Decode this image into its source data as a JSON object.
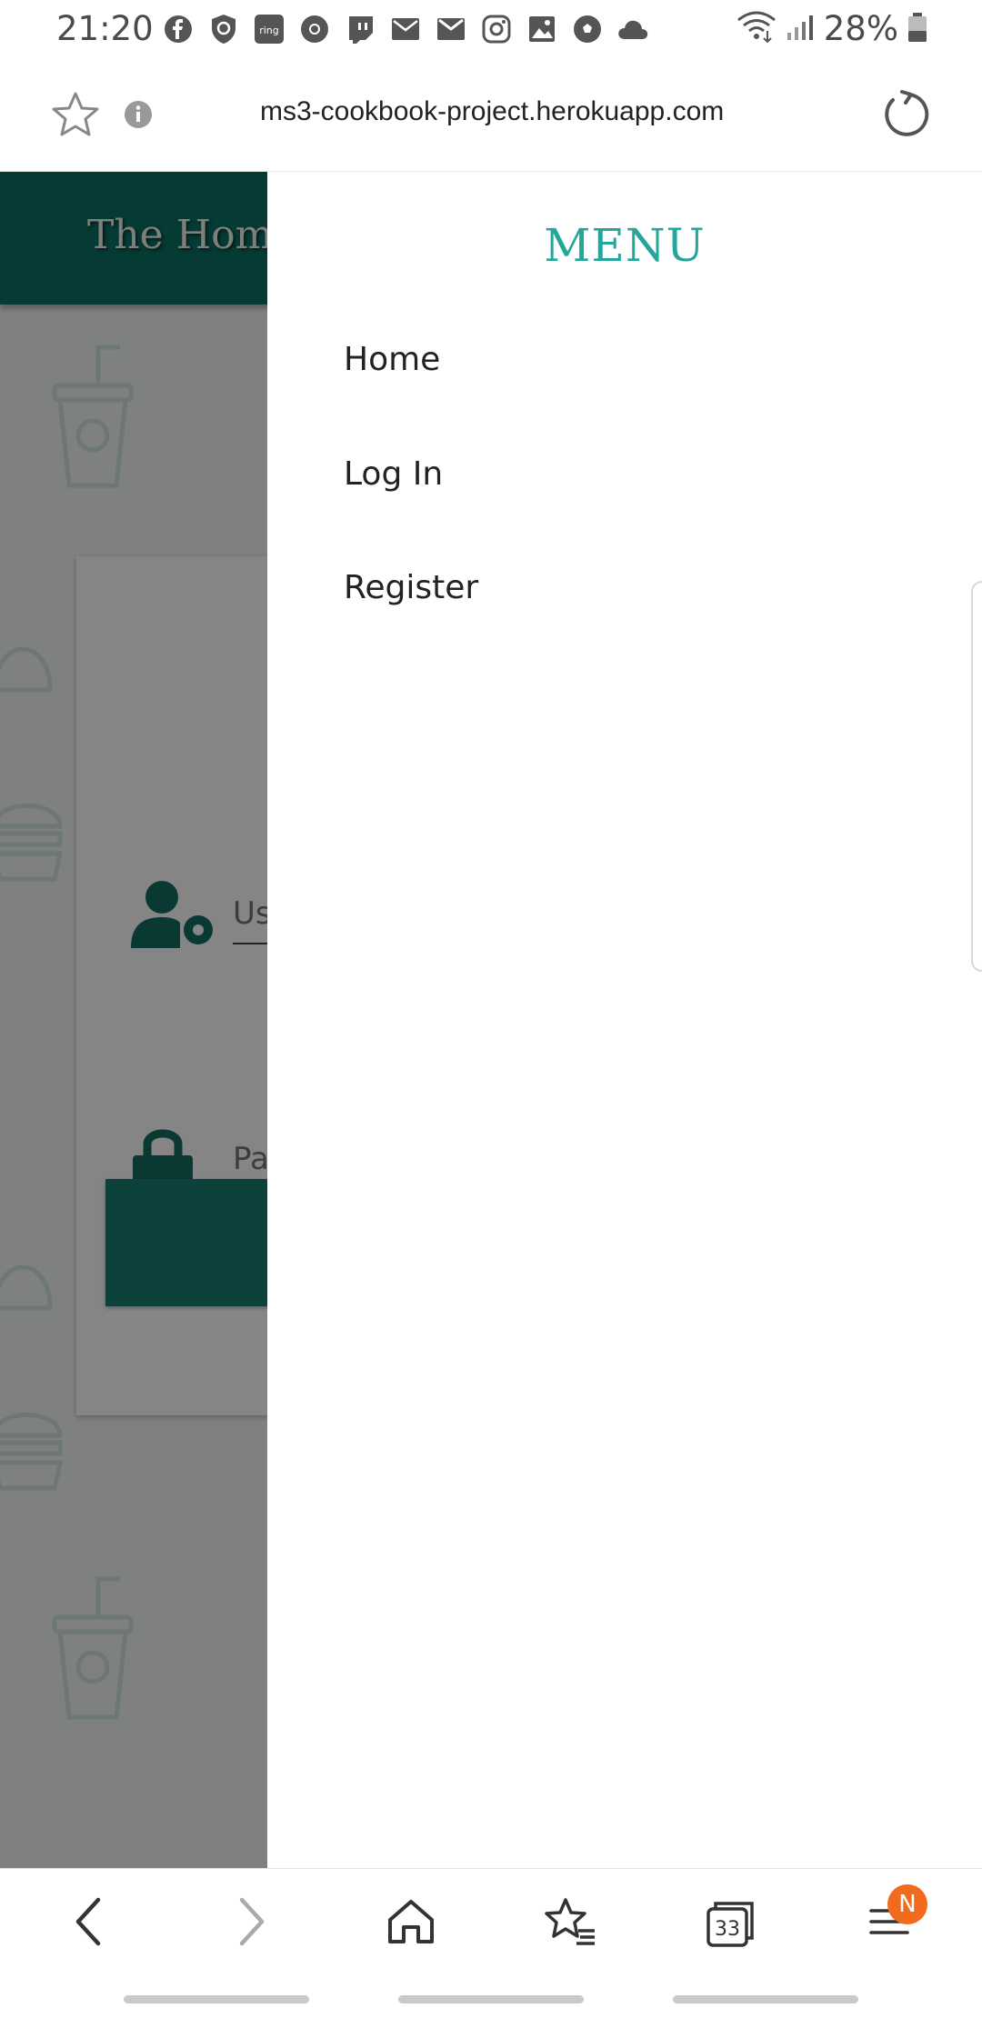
{
  "status_bar": {
    "time": "21:20",
    "notification_icons": [
      "facebook-icon",
      "shield-icon",
      "ring-icon",
      "chrome-icon",
      "twitch-icon",
      "mail-icon",
      "gmail-icon",
      "instagram-icon",
      "gallery-icon",
      "soccer-icon",
      "cloud-icon"
    ],
    "ring_label": "ring",
    "battery_percent": "28%"
  },
  "browser": {
    "url": "ms3-cookbook-project.herokuapp.com",
    "tabs_count": "33",
    "menu_badge": "N"
  },
  "page": {
    "brand": "The Home",
    "username_placeholder": "Us",
    "password_placeholder": "Pa"
  },
  "drawer": {
    "title": "MENU",
    "items": [
      {
        "label": "Home"
      },
      {
        "label": "Log In"
      },
      {
        "label": "Register"
      }
    ]
  },
  "colors": {
    "header_teal": "#0b6f66",
    "menu_title_teal": "#26a69a",
    "button_teal": "#1a7e74",
    "badge_orange": "#f26b1d"
  }
}
